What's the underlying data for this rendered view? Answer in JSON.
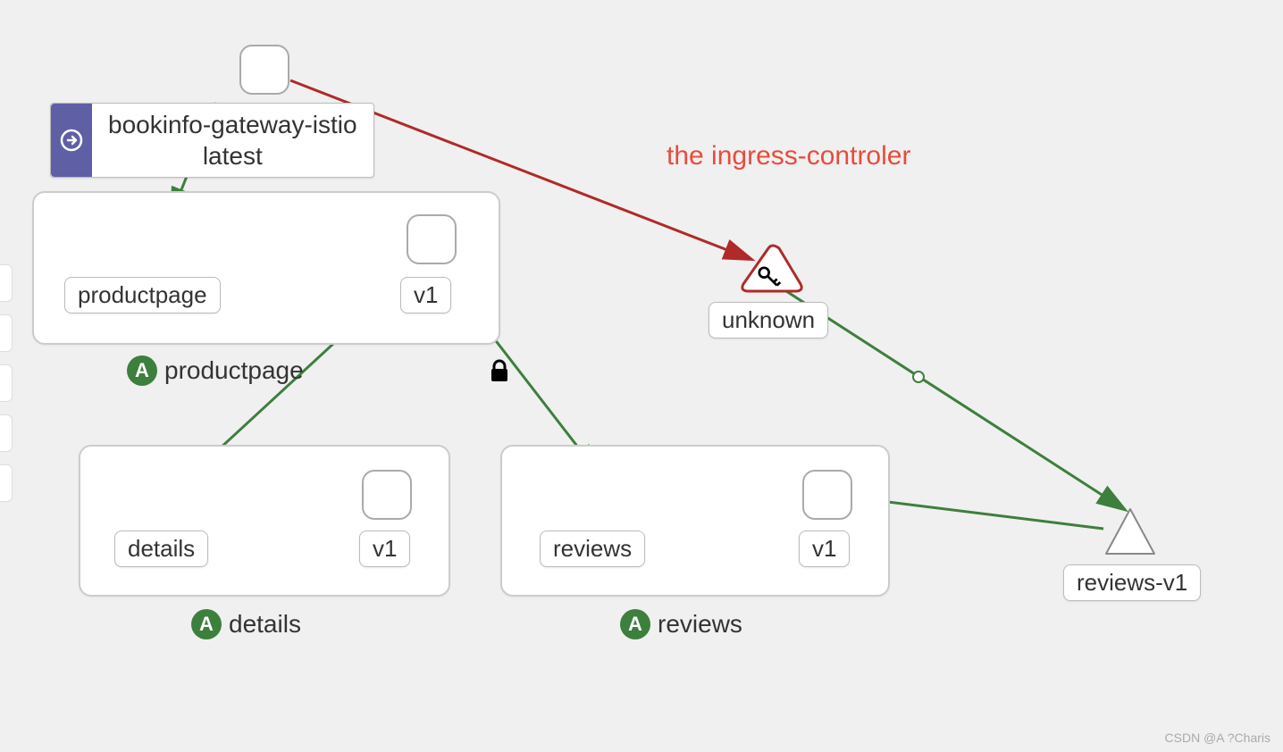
{
  "gateway": {
    "line1": "bookinfo-gateway-istio",
    "line2": "latest"
  },
  "services": {
    "productpage": {
      "label": "productpage",
      "serviceLabel": "productpage",
      "workloadLabel": "v1"
    },
    "details": {
      "label": "details",
      "serviceLabel": "details",
      "workloadLabel": "v1"
    },
    "reviews": {
      "label": "reviews",
      "serviceLabel": "reviews",
      "workloadLabel": "v1"
    }
  },
  "nodes": {
    "unknown": {
      "label": "unknown"
    },
    "reviewsV1": {
      "label": "reviews-v1"
    }
  },
  "badge": "A",
  "annotation": "the ingress-controler",
  "watermark": "CSDN @A ?Charis",
  "colors": {
    "edgeGreen": "#3d7f3d",
    "edgeRed": "#b02a2a",
    "annotation": "#e74c3c",
    "gatewayPurple": "#5f5fa6"
  }
}
